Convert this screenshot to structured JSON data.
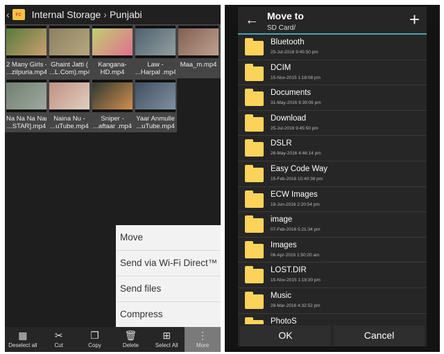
{
  "left": {
    "breadcrumb": {
      "root": "Internal Storage",
      "separator": "›",
      "folder": "Punjabi"
    },
    "files": [
      {
        "name1": "2 Many Girls -",
        "name2": "...zilpuria.mp4",
        "c1": "#5a7a3a",
        "c2": "#c9a070"
      },
      {
        "name1": "Ghaint Jatti (",
        "name2": "...L.Com).mp4",
        "c1": "#8a8060",
        "c2": "#b8a880"
      },
      {
        "name1": "Kangana-",
        "name2": "HD.mp4",
        "c1": "#c0d070",
        "c2": "#e07090"
      },
      {
        "name1": "Law  -",
        "name2": "...Harpal .mp4",
        "c1": "#506070",
        "c2": "#90a0a0"
      },
      {
        "name1": "Maa_m.mp4",
        "name2": "",
        "c1": "#806050",
        "c2": "#c0a090"
      },
      {
        "name1": "Na Na Na Na(",
        "name2": "...STAR].mp4",
        "c1": "#708070",
        "c2": "#a0a8a0"
      },
      {
        "name1": "Naina Nu -",
        "name2": "...uTube.mp4",
        "c1": "#c09080",
        "c2": "#e0d0c0"
      },
      {
        "name1": "Sniper -",
        "name2": "...aftaar .mp4",
        "c1": "#303830",
        "c2": "#d09050"
      },
      {
        "name1": "Yaar Anmulle",
        "name2": "...uTube.mp4",
        "c1": "#405060",
        "c2": "#8090a0"
      }
    ],
    "menu": [
      "Move",
      "Send via Wi-Fi Direct™",
      "Send files",
      "Compress"
    ],
    "toolbar": [
      {
        "label": "Deselect all",
        "icon": "deselect-all-icon",
        "glyph": "▦"
      },
      {
        "label": "Cut",
        "icon": "cut-icon",
        "glyph": "✂"
      },
      {
        "label": "Copy",
        "icon": "copy-icon",
        "glyph": "❐"
      },
      {
        "label": "Delete",
        "icon": "trash-icon",
        "glyph": "🗑"
      },
      {
        "label": "Select All",
        "icon": "select-all-icon",
        "glyph": "⊞"
      },
      {
        "label": "More",
        "icon": "more-vertical-icon",
        "glyph": "⋮"
      }
    ]
  },
  "dialog": {
    "title": "Move to",
    "path": "SD Card/",
    "folders": [
      {
        "name": "Bluetooth",
        "date": "25-Jul-2016 9:45:50 pm"
      },
      {
        "name": "DCIM",
        "date": "15-Nov-2015 1:18:08 pm"
      },
      {
        "name": "Documents",
        "date": "31-May-2016 9:39:06 pm"
      },
      {
        "name": "Download",
        "date": "25-Jul-2016 9:45:50 pm"
      },
      {
        "name": "DSLR",
        "date": "26-May-2016 4:46:14 pm"
      },
      {
        "name": "Easy Code Way",
        "date": "15-Feb-2016 10:40:38 pm"
      },
      {
        "name": "ECW Images",
        "date": "18-Jun-2016 2:20:54 pm"
      },
      {
        "name": "image",
        "date": "07-Feb-2016 5:21:34 pm"
      },
      {
        "name": "Images",
        "date": "06-Apr-2016 1:50:20 am"
      },
      {
        "name": "LOST.DIR",
        "date": "15-Nov-2015 1:18:30 pm"
      },
      {
        "name": "Music",
        "date": "28-Mar-2016 4:32:52 pm"
      },
      {
        "name": "PhotoS",
        "date": ""
      }
    ],
    "ok": "OK",
    "cancel": "Cancel"
  },
  "colors": {
    "accent": "#4aa3b8",
    "folder": "#fbd35a"
  }
}
